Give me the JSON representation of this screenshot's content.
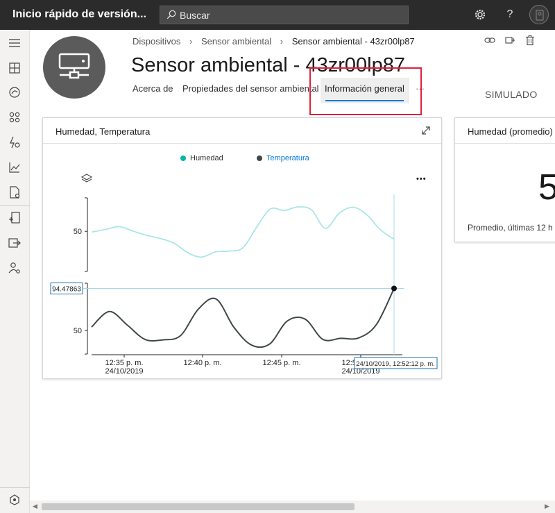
{
  "app": {
    "title": "Inicio rápido de versión..."
  },
  "search": {
    "placeholder": "Buscar"
  },
  "topbar_icons": [
    "settings-icon",
    "help-icon",
    "user-avatar"
  ],
  "sidebar": {
    "items": [
      "menu-icon",
      "dashboard-icon",
      "analytics-icon",
      "apps-icon",
      "rules-icon",
      "chart-icon",
      "jobs-icon",
      "device-template-icon",
      "export-icon",
      "administration-icon"
    ],
    "bottom": "extension-icon"
  },
  "breadcrumb": {
    "items": [
      "Dispositivos",
      "Sensor ambiental",
      "Sensor ambiental - 43zr00lp87"
    ]
  },
  "device": {
    "name": "Sensor ambiental - 43zr00lp87",
    "status": "SIMULADO"
  },
  "tabs": [
    {
      "label": "Acerca de"
    },
    {
      "label": "Propiedades del sensor ambiental"
    },
    {
      "label": "Información general"
    },
    {
      "label": "···"
    }
  ],
  "chart_card": {
    "title": "Humedad, Temperatura",
    "more_label": "•••"
  },
  "chart_data": {
    "type": "line",
    "legend": [
      {
        "name": "Humedad",
        "color": "#a9e6e6"
      },
      {
        "name": "Temperatura",
        "color": "#3d4848",
        "highlighted": true
      }
    ],
    "x_ticks": [
      {
        "time": "12:35 p. m.",
        "date": "24/10/2019"
      },
      {
        "time": "12:40 p. m.",
        "date": ""
      },
      {
        "time": "12:45 p. m.",
        "date": ""
      },
      {
        "time": "12:50 p. m.",
        "date": "24/10/2019"
      }
    ],
    "series": [
      {
        "name": "Humedad",
        "y_tick": "50",
        "values": [
          49.4,
          51.3,
          53.5,
          50.2,
          47.0,
          44.6,
          41.1,
          34.0,
          30.7,
          34.6,
          35.2,
          37.6,
          53.0,
          66.7,
          65.5,
          68.2,
          66.0,
          52.2,
          63.4,
          68.0,
          62.6,
          51.2,
          44.0
        ]
      },
      {
        "name": "Temperatura",
        "y_tick": "50",
        "values": [
          53.6,
          70.0,
          55.8,
          40.5,
          40.0,
          44.5,
          72.6,
          83.3,
          53.3,
          34.4,
          35.5,
          60.0,
          62.0,
          40.5,
          41.6,
          42.0,
          56.0,
          94.47863
        ]
      }
    ],
    "hover": {
      "value_label": "94.47863",
      "time_label": "24/10/2019, 12:52:12 p. m."
    }
  },
  "kpi_card": {
    "title": "Humedad (promedio)",
    "value": "5",
    "subtitle": "Promedio, últimas 12 h"
  }
}
